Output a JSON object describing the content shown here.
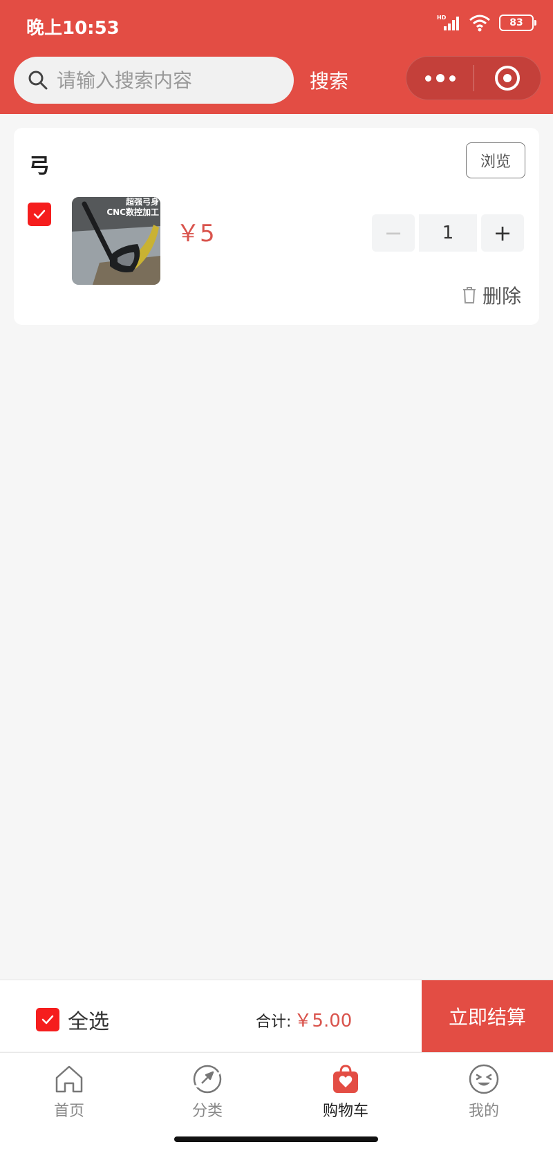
{
  "status_bar": {
    "time": "晚上10:53",
    "battery": "83",
    "network_badge": "HD"
  },
  "header": {
    "search": {
      "placeholder": "请输入搜索内容",
      "value": ""
    },
    "search_button": "搜索",
    "icons": {
      "search": "search-icon",
      "more": "more-dots-icon",
      "close": "target-circle-icon"
    },
    "accent_color": "#e34d44"
  },
  "cart": {
    "shop_name": "弓",
    "browse_label": "浏览",
    "items": [
      {
        "checked": true,
        "image_caption_line1": "超强弓身",
        "image_caption_line2": "CNC数控加工",
        "price": "￥5",
        "quantity": "1",
        "minus_label": "−",
        "plus_label": "+",
        "delete_label": "删除"
      }
    ]
  },
  "checkout": {
    "select_all_label": "全选",
    "total_label": "合计:",
    "total_amount": "￥5.00",
    "pay_label": "立即结算"
  },
  "tabbar": {
    "tabs": [
      {
        "label": "首页",
        "icon": "home-icon",
        "active": false
      },
      {
        "label": "分类",
        "icon": "category-icon",
        "active": false
      },
      {
        "label": "购物车",
        "icon": "cart-bag-icon",
        "active": true
      },
      {
        "label": "我的",
        "icon": "profile-face-icon",
        "active": false
      }
    ]
  }
}
